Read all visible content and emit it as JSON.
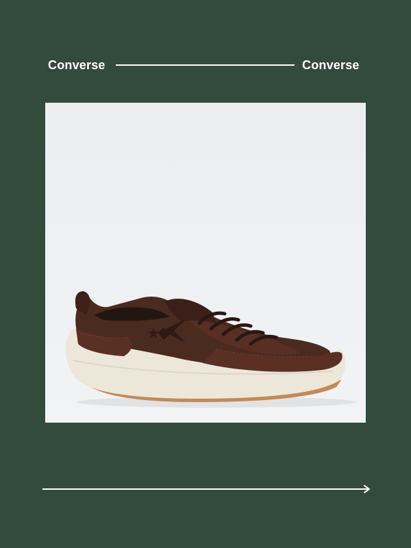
{
  "header": {
    "brand_left": "Converse",
    "brand_right": "Converse"
  },
  "product": {
    "image_subject": "brown low-top sneaker, side view",
    "colors": {
      "background": "#334b3c",
      "upper": "#4b2a20",
      "sole": "#ece7d9",
      "gum_outsole": "#c08a5a",
      "accent_line": "#ffffff"
    }
  },
  "icons": {
    "arrow": "arrow-right-icon",
    "logo": "star-chevron-logo-icon"
  }
}
